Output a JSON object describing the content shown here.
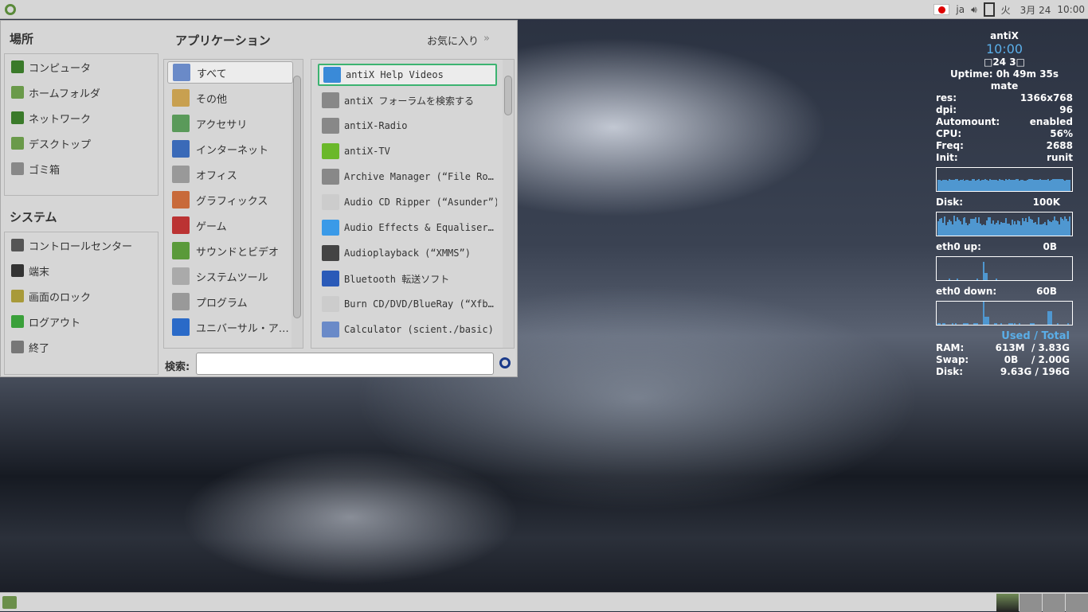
{
  "topbar": {
    "lang": "ja",
    "weekday": "火",
    "date": "3月 24",
    "time": "10:00"
  },
  "menu": {
    "places_title": "場所",
    "system_title": "システム",
    "apps_title": "アプリケーション",
    "favorites": "お気に入り",
    "search_label": "検索:",
    "search_value": "",
    "places": [
      "コンピュータ",
      "ホームフォルダ",
      "ネットワーク",
      "デスクトップ",
      "ゴミ箱"
    ],
    "system": [
      "コントロールセンター",
      "端末",
      "画面のロック",
      "ログアウト",
      "終了"
    ],
    "categories": [
      "すべて",
      "その他",
      "アクセサリ",
      "インターネット",
      "オフィス",
      "グラフィックス",
      "ゲーム",
      "サウンドとビデオ",
      "システムツール",
      "プログラム",
      "ユニバーサル・ア…"
    ],
    "apps": [
      "antiX Help Videos",
      "antiX フォーラムを検索する",
      "antiX-Radio",
      "antiX-TV",
      "Archive Manager (“File Ro…",
      "Audio CD Ripper (“Asunder”)",
      "Audio Effects & Equaliser…",
      "Audioplayback (“XMMS”)",
      "Bluetooth 転送ソフト",
      "Burn CD/DVD/BlueRay (“Xfb…",
      "Calculator (scient./basic)"
    ]
  },
  "conky": {
    "host": "antiX",
    "time": "10:00",
    "date": "□24  3□",
    "uptime": "Uptime: 0h 49m 35s",
    "user": "mate",
    "stats": [
      [
        "res:",
        "1366x768"
      ],
      [
        "dpi:",
        "96"
      ],
      [
        "Automount:",
        "enabled"
      ],
      [
        "CPU:",
        "56%"
      ],
      [
        "Freq:",
        "2688"
      ],
      [
        "Init:",
        "runit"
      ]
    ],
    "disk_label": "Disk:",
    "disk_val": "100K",
    "up_label": "eth0 up:",
    "up_val": "0B",
    "down_label": "eth0 down:",
    "down_val": "60B",
    "used_total": "Used / Total",
    "mem": [
      [
        "RAM:",
        "613M  / 3.83G"
      ],
      [
        "Swap:",
        "0B    / 2.00G"
      ],
      [
        "Disk:",
        "9.63G / 196G"
      ]
    ]
  },
  "colors": {
    "accent": "#3cb371",
    "graph": "#4f97d0",
    "time": "#5aaee8"
  }
}
